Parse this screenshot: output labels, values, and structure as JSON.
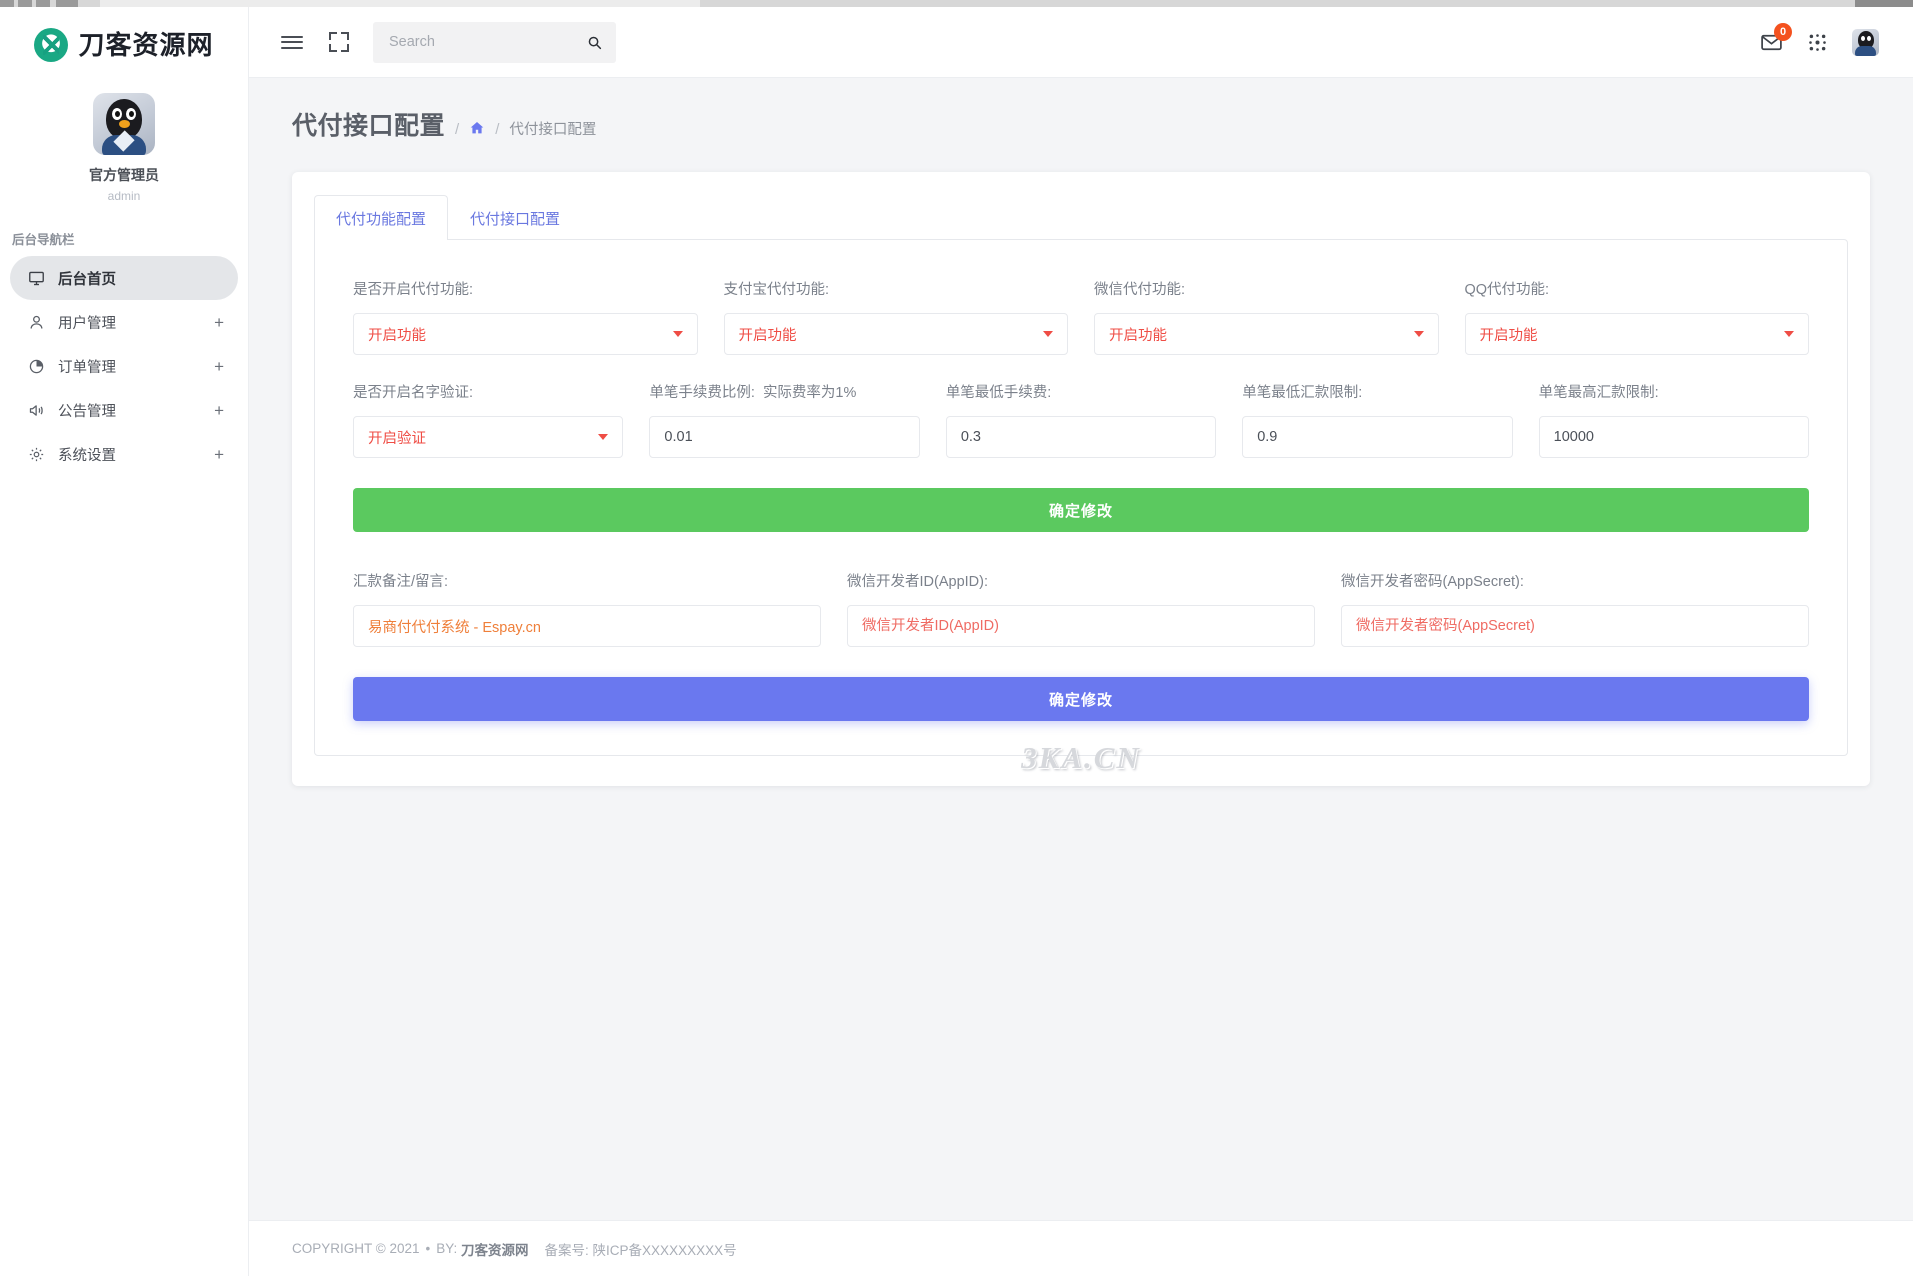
{
  "browser": {
    "chrome_visible": true
  },
  "sidebar": {
    "brand": {
      "title": "刀客资源网",
      "logo_icon": "leaf-circle-logo"
    },
    "profile": {
      "name": "官方管理员",
      "username": "admin",
      "avatar_icon": "qq-penguin-avatar"
    },
    "nav_caption": "后台导航栏",
    "items": [
      {
        "label": "后台首页",
        "icon": "monitor-icon",
        "active": true,
        "expandable": false,
        "expand_symbol": ""
      },
      {
        "label": "用户管理",
        "icon": "user-icon",
        "active": false,
        "expandable": true,
        "expand_symbol": "+"
      },
      {
        "label": "订单管理",
        "icon": "pie-chart-icon",
        "active": false,
        "expandable": true,
        "expand_symbol": "+"
      },
      {
        "label": "公告管理",
        "icon": "megaphone-icon",
        "active": false,
        "expandable": true,
        "expand_symbol": "+"
      },
      {
        "label": "系统设置",
        "icon": "gear-icon",
        "active": false,
        "expandable": true,
        "expand_symbol": "+"
      }
    ]
  },
  "header": {
    "menu_toggle_icon": "hamburger-icon",
    "fullscreen_icon": "expand-icon",
    "search": {
      "placeholder": "Search",
      "value": "",
      "button_icon": "search-icon"
    },
    "mail": {
      "icon": "envelope-icon",
      "badge": "0"
    },
    "apps_icon": "grid-apps-icon",
    "user_avatar_icon": "qq-penguin-avatar"
  },
  "page": {
    "title": "代付接口配置",
    "breadcrumb": {
      "sep": "/",
      "home_icon": "home-icon",
      "current": "代付接口配置"
    }
  },
  "tabs": [
    {
      "label": "代付功能配置",
      "active": true
    },
    {
      "label": "代付接口配置",
      "active": false
    }
  ],
  "form": {
    "row1": [
      {
        "label": "是否开启代付功能:",
        "value": "开启功能",
        "type": "select"
      },
      {
        "label": "支付宝代付功能:",
        "value": "开启功能",
        "type": "select"
      },
      {
        "label": "微信代付功能:",
        "value": "开启功能",
        "type": "select"
      },
      {
        "label": "QQ代付功能:",
        "value": "开启功能",
        "type": "select"
      }
    ],
    "row2": [
      {
        "label": "是否开启名字验证:",
        "value": "开启验证",
        "type": "select"
      },
      {
        "label": "单笔手续费比例:",
        "label_sub": "实际费率为1%",
        "value": "0.01",
        "type": "input"
      },
      {
        "label": "单笔最低手续费:",
        "value": "0.3",
        "type": "input"
      },
      {
        "label": "单笔最低汇款限制:",
        "value": "0.9",
        "type": "input"
      },
      {
        "label": "单笔最高汇款限制:",
        "value": "10000",
        "type": "input"
      }
    ],
    "submit_primary": "确定修改",
    "row3": [
      {
        "label": "汇款备注/留言:",
        "value": "易商付代付系统 - Espay.cn",
        "placeholder": "",
        "style": "value-orange"
      },
      {
        "label": "微信开发者ID(AppID):",
        "value": "",
        "placeholder": "微信开发者ID(AppID)",
        "style": "placeholder-red"
      },
      {
        "label": "微信开发者密码(AppSecret):",
        "value": "",
        "placeholder": "微信开发者密码(AppSecret)",
        "style": "placeholder-red"
      }
    ],
    "submit_secondary": "确定修改"
  },
  "watermark": "3KA.CN",
  "footer": {
    "copyright": "COPYRIGHT © 2021",
    "dot": "•",
    "by_label": "BY:",
    "by_name": "刀客资源网",
    "record_label": "备案号:",
    "record_value": "陕ICP备XXXXXXXXX号"
  },
  "colors": {
    "accent_blue": "#6a78ef",
    "success_green": "#5bc95f",
    "danger_red": "#ef4d45",
    "badge_orange": "#f4511e",
    "page_bg": "#f4f5f7"
  }
}
